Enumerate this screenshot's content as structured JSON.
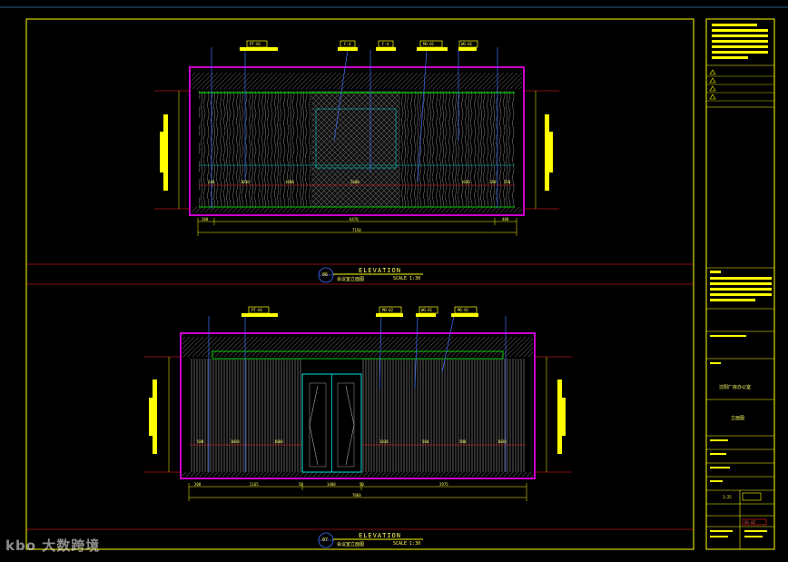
{
  "colors": {
    "background": "#000000",
    "frame": "#ffff00",
    "wall": "#cc00cc",
    "section_line": "#ff2020",
    "leader": "#3060ff",
    "cyan": "#00e0e0",
    "green": "#00ff00"
  },
  "elevation_top": {
    "number": "06",
    "title": "ELEVATION",
    "subtitle": "会议室立面图",
    "scale": "SCALE 1:30",
    "dimensions": {
      "overall": "7150",
      "segments": [
        "200",
        "6470",
        "480"
      ],
      "inner": [
        "240",
        "1030",
        "1600",
        "2600",
        "1030",
        "240",
        "350"
      ]
    },
    "material_tags": [
      "PT-01",
      "F-4",
      "F-4",
      "MO-01",
      "WO-01"
    ]
  },
  "elevation_bottom": {
    "number": "07",
    "title": "ELEVATION",
    "subtitle": "会议室立面图",
    "scale": "SCALE 1:30",
    "dimensions": {
      "overall": "7060",
      "segments": [
        "200",
        "2165",
        "50",
        "1400",
        "50",
        "2975"
      ],
      "inner": [
        "500",
        "1030",
        "1600",
        "1030",
        "500",
        "500",
        "1030"
      ]
    },
    "material_tags": [
      "PT-01",
      "MO-02",
      "WO-01",
      "MO-01"
    ]
  },
  "title_block": {
    "project_name": "沈阳厂房办公室",
    "drawing_name": "立面图",
    "scale_text": "1:25",
    "drawing_number": "XG-02"
  },
  "watermark": "大数跨境"
}
